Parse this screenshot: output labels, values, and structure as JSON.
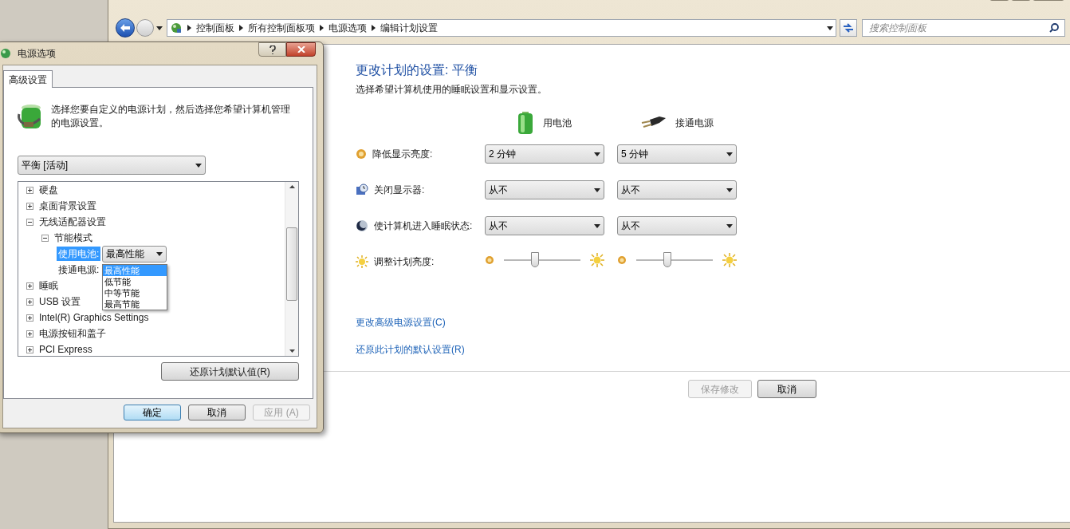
{
  "main_window": {
    "breadcrumbs": [
      "控制面板",
      "所有控制面板项",
      "电源选项",
      "编辑计划设置"
    ],
    "search": {
      "placeholder": "搜索控制面板"
    },
    "title": "更改计划的设置: 平衡",
    "subtitle": "选择希望计算机使用的睡眠设置和显示设置。",
    "columns": [
      "用电池",
      "接通电源"
    ],
    "settings": [
      {
        "kind": "dropdown",
        "label": "降低显示亮度:",
        "values": [
          "2 分钟",
          "5 分钟"
        ]
      },
      {
        "kind": "dropdown",
        "label": "关闭显示器:",
        "values": [
          "从不",
          "从不"
        ]
      },
      {
        "kind": "dropdown",
        "label": "使计算机进入睡眠状态:",
        "values": [
          "从不",
          "从不"
        ]
      },
      {
        "kind": "slider",
        "label": "调整计划亮度:",
        "sliders": [
          {
            "level": 0.41
          },
          {
            "level": 0.41
          }
        ]
      }
    ],
    "links": [
      "更改高级电源设置(C)",
      "还原此计划的默认设置(R)"
    ],
    "buttons": [
      {
        "label": "保存修改",
        "disabled": true
      },
      {
        "label": "取消",
        "disabled": false
      }
    ]
  },
  "dialog": {
    "title": "电源选项",
    "tabs": [
      {
        "label": "高级设置",
        "selected": true
      }
    ],
    "description": "选择您要自定义的电源计划，然后选择您希望计算机管理的电源设置。",
    "plan": "平衡 [活动]",
    "tree": [
      {
        "kind": "group",
        "label": "硬盘",
        "expanded": false,
        "selected": false
      },
      {
        "kind": "group",
        "label": "桌面背景设置",
        "expanded": false,
        "selected": false
      },
      {
        "kind": "group",
        "label": "无线适配器设置",
        "expanded": true,
        "selected": false,
        "children": [
          {
            "kind": "group",
            "label": "节能模式",
            "expanded": true,
            "selected": false,
            "children": [
              {
                "kind": "setting",
                "label": "使用电池:",
                "value": "最高性能",
                "selected": true,
                "open": true,
                "options": [
                  {
                    "label": "最高性能",
                    "selected": true
                  },
                  {
                    "label": "低节能",
                    "selected": false
                  },
                  {
                    "label": "中等节能",
                    "selected": false
                  },
                  {
                    "label": "最高节能",
                    "selected": false
                  }
                ]
              },
              {
                "kind": "setting",
                "label": "接通电源:",
                "selected": false
              }
            ]
          }
        ]
      },
      {
        "kind": "group",
        "label": "睡眠",
        "expanded": false,
        "selected": false
      },
      {
        "kind": "group",
        "label": "USB 设置",
        "expanded": false,
        "selected": false
      },
      {
        "kind": "group",
        "label": "Intel(R) Graphics Settings",
        "expanded": false,
        "selected": false
      },
      {
        "kind": "group",
        "label": "电源按钮和盖子",
        "expanded": false,
        "selected": false
      },
      {
        "kind": "group",
        "label": "PCI Express",
        "expanded": false,
        "selected": false
      }
    ],
    "restore_button": "还原计划默认值(R)",
    "buttons": [
      {
        "label": "确定",
        "default": true,
        "disabled": false
      },
      {
        "label": "取消",
        "default": false,
        "disabled": false
      },
      {
        "label": "应用 (A)",
        "default": false,
        "disabled": true
      }
    ]
  }
}
